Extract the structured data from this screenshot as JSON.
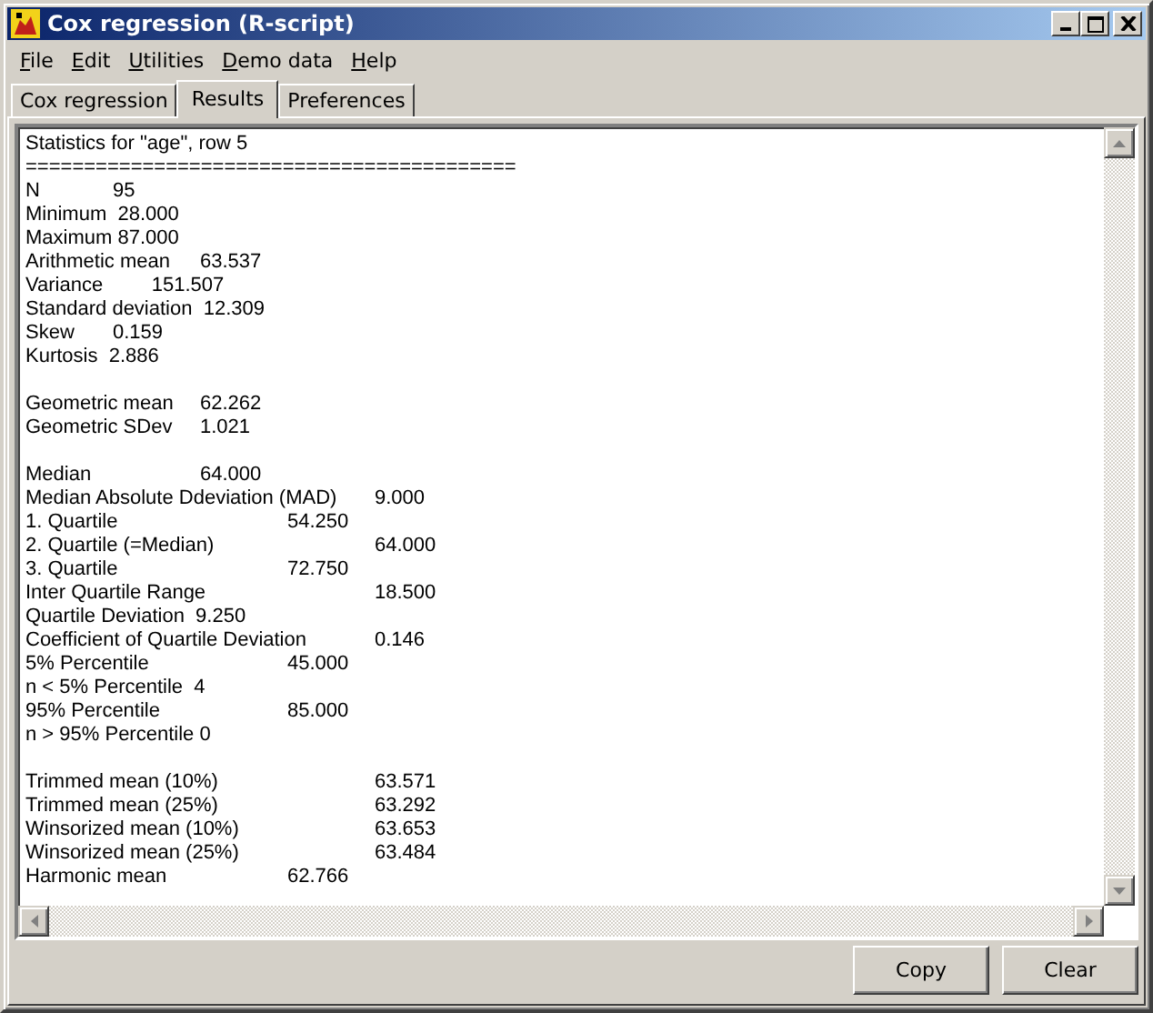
{
  "window": {
    "title": "Cox regression (R-script)"
  },
  "menu": [
    "File",
    "Edit",
    "Utilities",
    "Demo data",
    "Help"
  ],
  "tabs": [
    {
      "label": "Cox regression",
      "selected": false
    },
    {
      "label": "Results",
      "selected": true
    },
    {
      "label": "Preferences",
      "selected": false
    }
  ],
  "output": {
    "blocks": [
      [
        "Statistics for \"age\", row 5",
        "==========================================",
        "N\t95",
        "Minimum  28.000",
        "Maximum 87.000",
        "Arithmetic mean\t63.537",
        "Variance\t       151.507",
        "Standard deviation  12.309",
        "Skew\t0.159",
        "Kurtosis  2.886"
      ],
      [
        "Geometric mean\t62.262",
        "Geometric SDev\t1.021"
      ],
      [
        "Median\t\t64.000",
        "Median Absolute Ddeviation (MAD)\t9.000",
        "1. Quartile\t\t54.250",
        "2. Quartile (=Median)\t\t64.000",
        "3. Quartile\t\t72.750",
        "Inter Quartile Range\t\t18.500",
        "Quartile Deviation  9.250",
        "Coefficient of Quartile Deviation\t0.146",
        "5% Percentile\t\t45.000",
        "n < 5% Percentile  4",
        "95% Percentile\t\t85.000",
        "n > 95% Percentile 0"
      ],
      [
        "Trimmed mean (10%)\t\t63.571",
        "Trimmed mean (25%)\t\t63.292",
        "Winsorized mean (10%)\t\t63.653",
        "Winsorized mean (25%)\t\t63.484",
        "Harmonic mean\t\t62.766"
      ]
    ]
  },
  "buttons": [
    "Copy",
    "Clear"
  ]
}
